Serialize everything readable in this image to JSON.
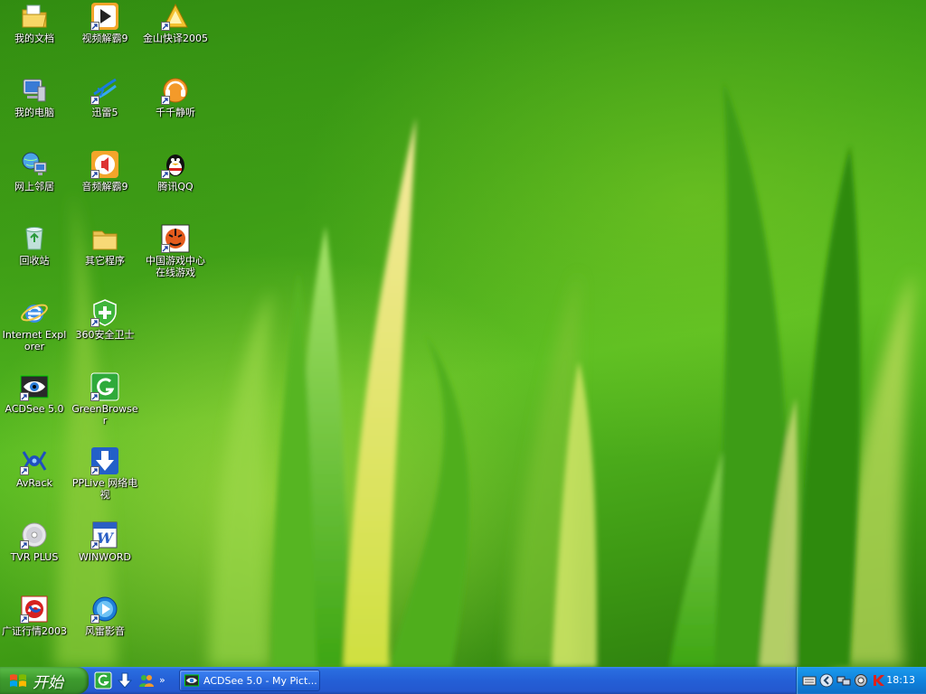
{
  "desktop": {
    "icons": [
      {
        "label": "我的文档",
        "icon": "my-documents-icon"
      },
      {
        "label": "视频解霸9",
        "icon": "video-player-icon"
      },
      {
        "label": "金山快译2005",
        "icon": "translator-icon"
      },
      {
        "label": "我的电脑",
        "icon": "my-computer-icon"
      },
      {
        "label": "迅雷5",
        "icon": "thunder-download-icon"
      },
      {
        "label": "千千静听",
        "icon": "music-player-icon"
      },
      {
        "label": "网上邻居",
        "icon": "network-places-icon"
      },
      {
        "label": "音频解霸9",
        "icon": "audio-player-icon"
      },
      {
        "label": "腾讯QQ",
        "icon": "qq-penguin-icon"
      },
      {
        "label": "回收站",
        "icon": "recycle-bin-icon"
      },
      {
        "label": "其它程序",
        "icon": "folder-icon"
      },
      {
        "label": "中国游戏中心在线游戏",
        "icon": "game-center-icon"
      },
      {
        "label": "Internet Explorer",
        "icon": "internet-explorer-icon"
      },
      {
        "label": "360安全卫士",
        "icon": "security-shield-icon"
      },
      {
        "label": "ACDSee 5.0",
        "icon": "acdsee-eye-icon"
      },
      {
        "label": "GreenBrowser",
        "icon": "greenbrowser-icon"
      },
      {
        "label": "AvRack",
        "icon": "avrack-icon"
      },
      {
        "label": "PPLive 网络电视",
        "icon": "pplive-icon"
      },
      {
        "label": "TVR PLUS",
        "icon": "tvr-disc-icon"
      },
      {
        "label": "WINWORD",
        "icon": "word-document-icon"
      },
      {
        "label": "广证行情2003",
        "icon": "stock-quotes-icon"
      },
      {
        "label": "风雷影音",
        "icon": "media-player-icon"
      }
    ]
  },
  "taskbar": {
    "start_label": "开始",
    "quick_launch": [
      "greenbrowser-icon",
      "download-arrow-icon",
      "messenger-icon"
    ],
    "tasks": [
      {
        "label": "ACDSee 5.0 - My Pict...",
        "icon": "acdsee-eye-icon"
      }
    ],
    "tray_icons": [
      "keyboard-icon",
      "back-arrow-icon",
      "network-icon",
      "shield-icon",
      "antivirus-k-icon"
    ],
    "clock": "18:13"
  }
}
